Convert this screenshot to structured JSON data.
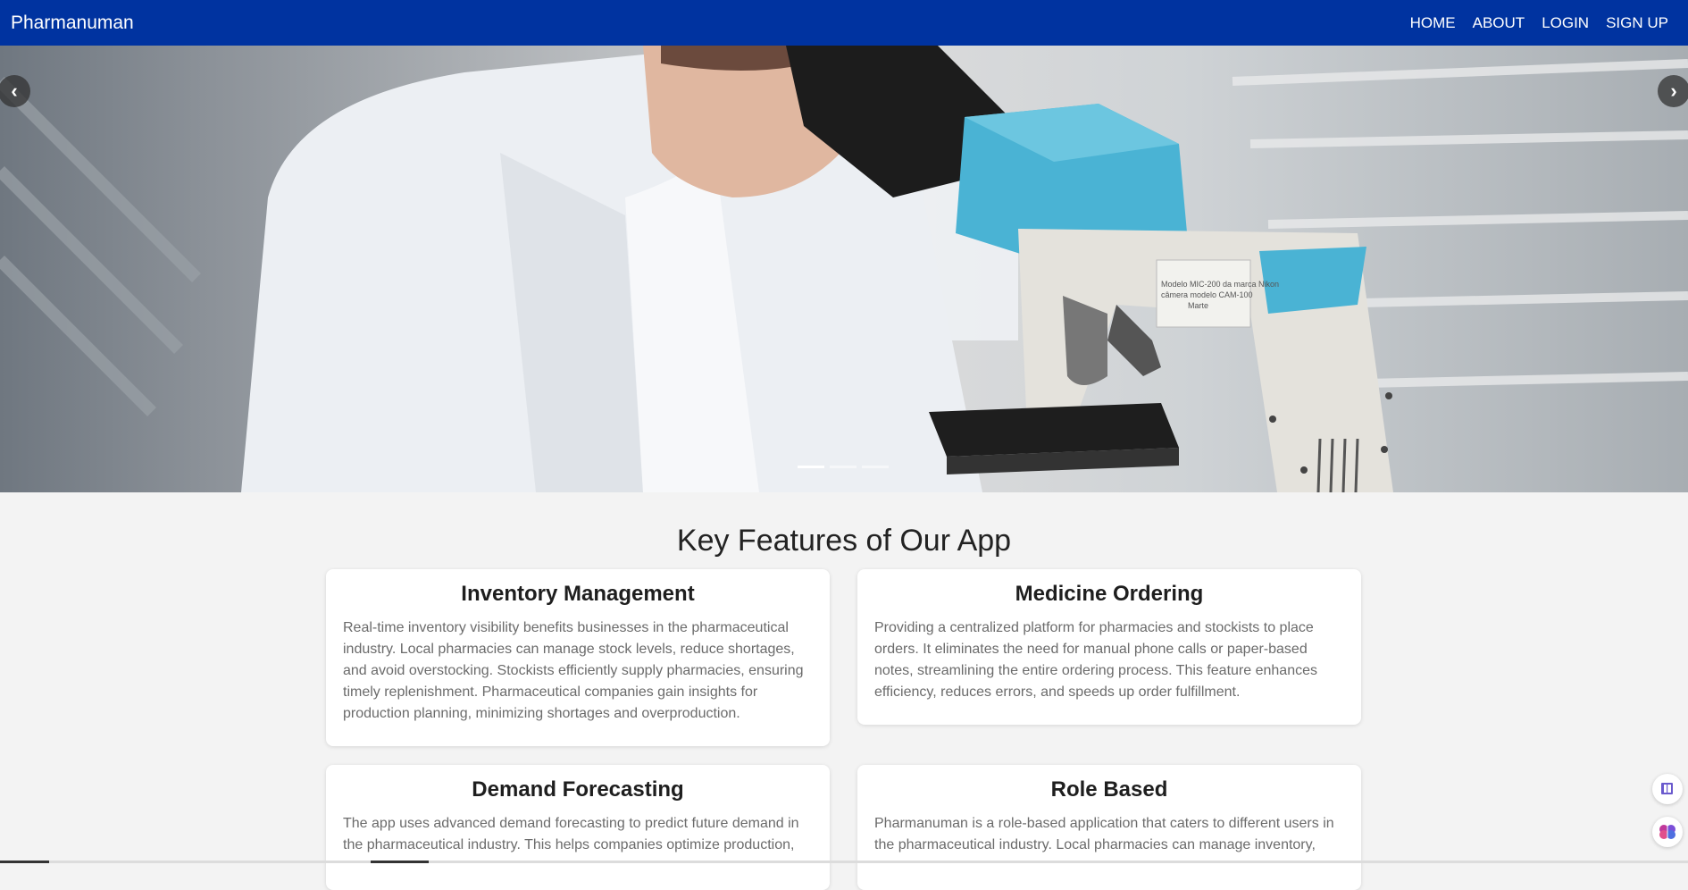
{
  "nav": {
    "brand": "Pharmanuman",
    "links": [
      "HOME",
      "ABOUT",
      "LOGIN",
      "SIGN UP"
    ]
  },
  "carousel": {
    "prev_icon": "chevron-left-icon",
    "next_icon": "chevron-right-icon",
    "slides": 3,
    "active_slide": 1,
    "image_text": "Modelo MIC-200 da marca Nikon câmera modelo CAM-100 Marte"
  },
  "features": {
    "title": "Key Features of Our App",
    "cards": [
      {
        "title": "Inventory Management",
        "text": "Real-time inventory visibility benefits businesses in the pharmaceutical industry. Local pharmacies can manage stock levels, reduce shortages, and avoid overstocking. Stockists efficiently supply pharmacies, ensuring timely replenishment. Pharmaceutical companies gain insights for production planning, minimizing shortages and overproduction."
      },
      {
        "title": "Medicine Ordering",
        "text": "Providing a centralized platform for pharmacies and stockists to place orders. It eliminates the need for manual phone calls or paper-based notes, streamlining the entire ordering process. This feature enhances efficiency, reduces errors, and speeds up order fulfillment."
      },
      {
        "title": "Demand Forecasting",
        "text": "The app uses advanced demand forecasting to predict future demand in the pharmaceutical industry. This helps companies optimize production,"
      },
      {
        "title": "Role Based",
        "text": "Pharmanuman is a role-based application that caters to different users in the pharmaceutical industry. Local pharmacies can manage inventory,"
      }
    ]
  },
  "floating": {
    "icons": [
      "book-icon",
      "brain-icon"
    ],
    "colors": {
      "book": "#6a5acd",
      "brain": "#c0399b"
    }
  },
  "colors": {
    "navbar": "#0033a0",
    "accent": "#4ab3d4"
  }
}
